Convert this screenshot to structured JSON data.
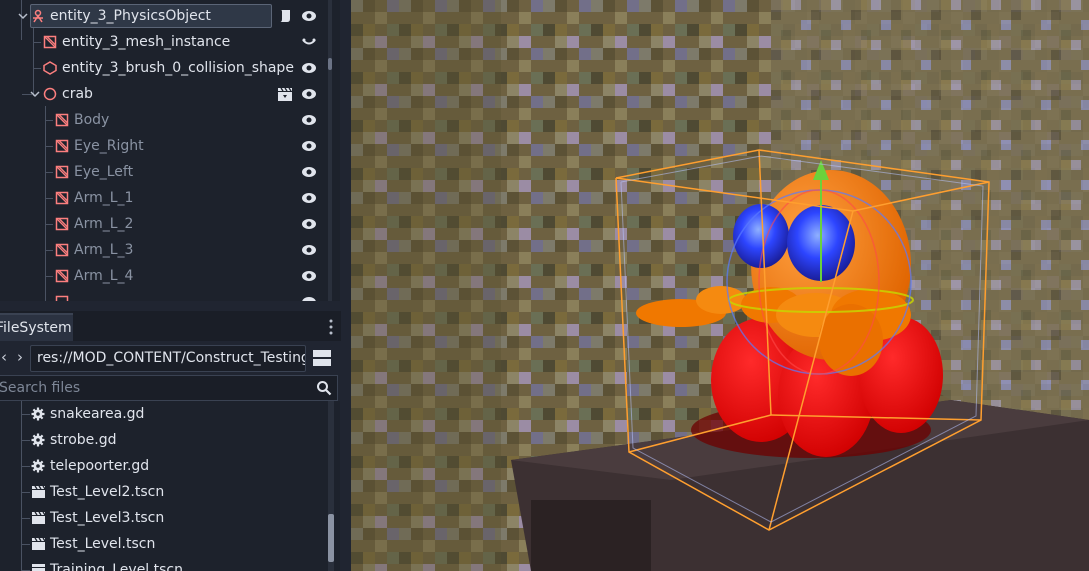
{
  "scene_tree": {
    "rows": [
      {
        "label": "entity_3_PhysicsObject",
        "selected": true,
        "icon": "physics-body-icon",
        "extra_icon": "script-icon"
      },
      {
        "label": "entity_3_mesh_instance",
        "icon": "mesh-instance-icon",
        "extra_icon": "signal-icon"
      },
      {
        "label": "entity_3_brush_0_collision_shape",
        "icon": "collision-shape-icon"
      },
      {
        "label": "crab",
        "icon": "node3d-icon",
        "extra_icon": "clapperboard-icon"
      },
      {
        "label": "Body",
        "icon": "mesh-instance-icon"
      },
      {
        "label": "Eye_Right",
        "icon": "mesh-instance-icon"
      },
      {
        "label": "Eye_Left",
        "icon": "mesh-instance-icon"
      },
      {
        "label": "Arm_L_1",
        "icon": "mesh-instance-icon"
      },
      {
        "label": "Arm_L_2",
        "icon": "mesh-instance-icon"
      },
      {
        "label": "Arm_L_3",
        "icon": "mesh-instance-icon"
      },
      {
        "label": "Arm_L_4",
        "icon": "mesh-instance-icon"
      }
    ]
  },
  "filesystem": {
    "tab_label": "FileSystem",
    "path": "res://MOD_CONTENT/Construct_Testing",
    "search_placeholder": "Search files",
    "files": [
      {
        "name": "snakearea.gd",
        "icon": "gear-icon"
      },
      {
        "name": "strobe.gd",
        "icon": "gear-icon"
      },
      {
        "name": "telepoorter.gd",
        "icon": "gear-icon"
      },
      {
        "name": "Test_Level2.tscn",
        "icon": "clapperboard-icon"
      },
      {
        "name": "Test_Level3.tscn",
        "icon": "clapperboard-icon"
      },
      {
        "name": "Test_Level.tscn",
        "icon": "clapperboard-icon"
      },
      {
        "name": "Training_Level.tscn",
        "icon": "clapperboard-icon"
      }
    ]
  },
  "colors": {
    "panel_bg": "#202531",
    "tree_bg": "#1d222c",
    "mesh_icon": "#fc7f7f",
    "physics_icon": "#fc7f7f",
    "selection_outline": "#ff9f2f",
    "crab_orange": "#ff7a00",
    "crab_red": "#ff0000",
    "eye_blue": "#2a3cff"
  }
}
